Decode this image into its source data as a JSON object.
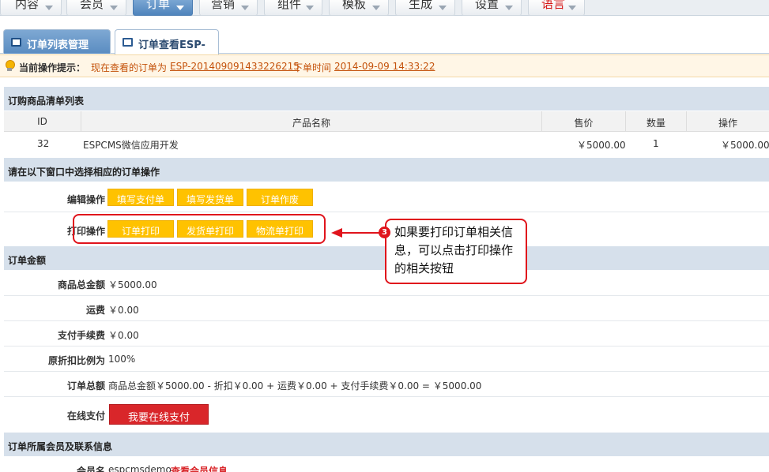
{
  "nav": {
    "items": [
      {
        "label": "内容"
      },
      {
        "label": "会员"
      },
      {
        "label": "订单"
      },
      {
        "label": "营销"
      },
      {
        "label": "组件"
      },
      {
        "label": "模板"
      },
      {
        "label": "生成"
      },
      {
        "label": "设置"
      },
      {
        "label": "语言"
      }
    ],
    "active": "订单"
  },
  "tabs": [
    {
      "label": "订单列表管理",
      "icon": "window-icon"
    },
    {
      "label": "订单查看ESP-",
      "icon": "window-icon"
    }
  ],
  "hint": {
    "label": "当前操作提示：",
    "prefix": "现在查看的订单为",
    "order_no": "ESP-201409091433226215",
    "mid": "下单时间",
    "time": "2014-09-09 14:33:22"
  },
  "products": {
    "title": "订购商品清单列表",
    "headers": [
      "ID",
      "产品名称",
      "售价",
      "数量",
      "操作"
    ],
    "rows": [
      {
        "id": "32",
        "name": "ESPCMS微信应用开发",
        "price": "￥5000.00",
        "qty": "1",
        "total": "￥5000.00"
      }
    ]
  },
  "ops": {
    "title": "请在以下窗口中选择相应的订单操作",
    "edit_label": "编辑操作",
    "edit_buttons": [
      "填写支付单",
      "填写发货单",
      "订单作废"
    ],
    "print_label": "打印操作",
    "print_buttons": [
      "订单打印",
      "发货单打印",
      "物流单打印"
    ]
  },
  "amount": {
    "title": "订单金额",
    "rows": [
      {
        "label": "商品总金额",
        "value": "￥5000.00"
      },
      {
        "label": "运费",
        "value": "￥0.00"
      },
      {
        "label": "支付手续费",
        "value": "￥0.00"
      },
      {
        "label": "原折扣比例为",
        "value": "100%"
      },
      {
        "label": "订单总额",
        "value": "商品总金额￥5000.00 - 折扣￥0.00 + 运费￥0.00 + 支付手续费￥0.00 = ￥5000.00"
      }
    ],
    "pay_label": "在线支付",
    "pay_button": "我要在线支付"
  },
  "member": {
    "title": "订单所属会员及联系信息",
    "name_label": "会员名",
    "name_value": "espcmsdemo",
    "link": "查看会员信息"
  },
  "annotation": {
    "number": "3",
    "text": "如果要打印订单相关信息，可以点击打印操作的相关按钮"
  },
  "colors": {
    "accent_blue": "#5a8cc1",
    "button_yellow": "#ffc200",
    "button_red": "#d9262a",
    "annotation_red": "#e0141c",
    "hint_orange": "#c4520b"
  }
}
